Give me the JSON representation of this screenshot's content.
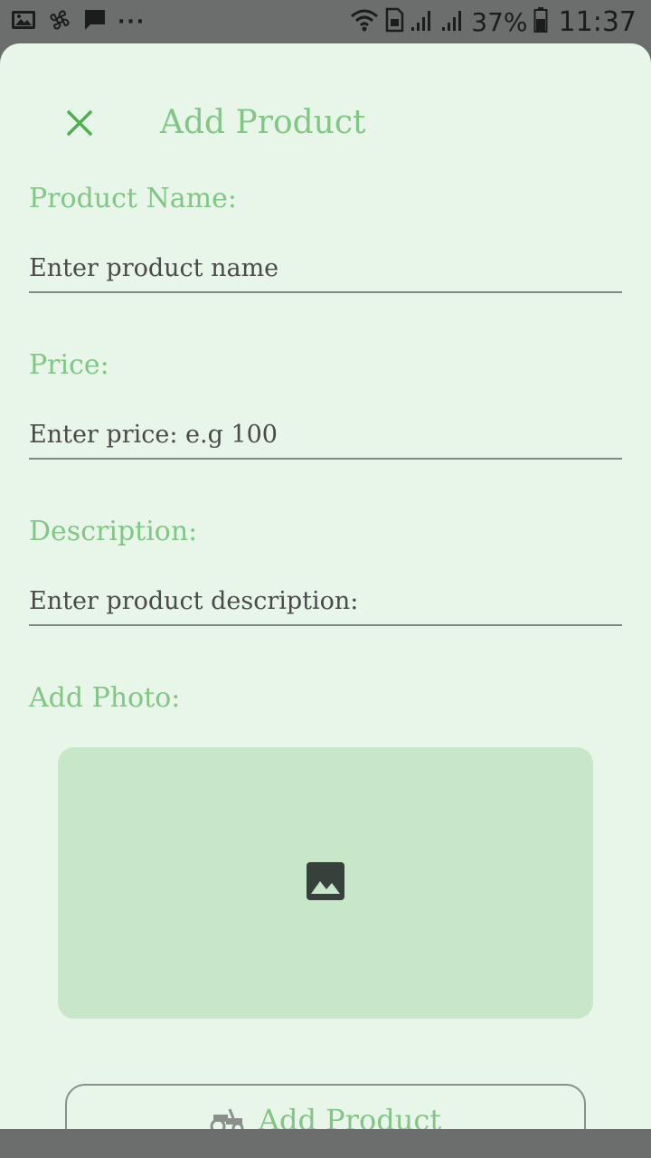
{
  "status_bar": {
    "overflow_dots": "···",
    "battery_percent": "37%",
    "time": "11:37",
    "icons": [
      "gallery-icon",
      "fan-icon",
      "message-icon",
      "wifi-icon",
      "sim-icon",
      "signal-icon",
      "signal-icon",
      "battery-icon"
    ]
  },
  "sheet": {
    "title": "Add Product",
    "close_icon": "close-icon",
    "fields": {
      "name": {
        "label": "Product Name:",
        "placeholder": "Enter product name"
      },
      "price": {
        "label": "Price:",
        "placeholder": "Enter price: e.g 100"
      },
      "description": {
        "label": "Description:",
        "placeholder": "Enter product description:"
      }
    },
    "photo": {
      "label": "Add Photo:",
      "icon": "image-icon"
    },
    "submit": {
      "label": "Add Product",
      "icon": "tractor-icon"
    }
  },
  "colors": {
    "accent": "#81c784",
    "accent_dark": "#4caf50",
    "sheet_background": "#e8f5e9",
    "photo_background": "#c8e6c9",
    "status_bar": "#6b6e6c"
  }
}
